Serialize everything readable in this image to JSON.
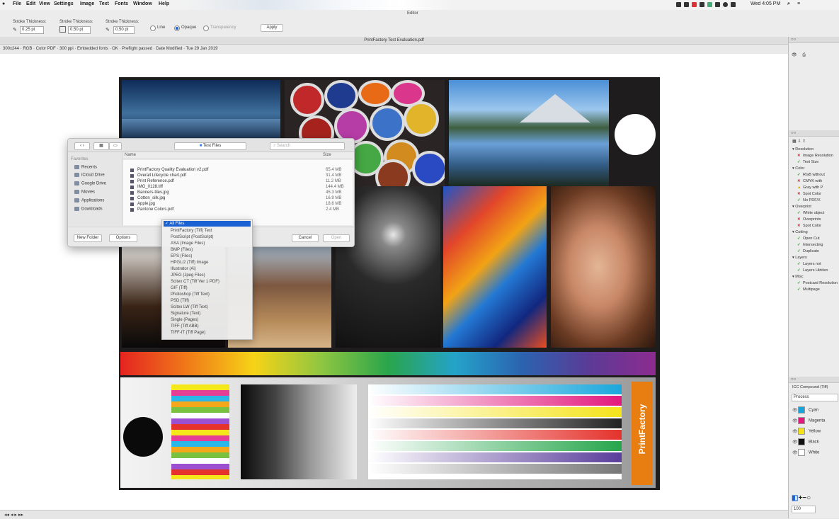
{
  "menubar": {
    "items": [
      "File",
      "Edit",
      "View",
      "Settings",
      "Image",
      "Text",
      "Fonts",
      "Window",
      "Help"
    ],
    "right_text": "Wed 4:05 PM"
  },
  "toolbar": {
    "title": "Editor",
    "group1_label": "Stroke Thickness:",
    "group1_value": "0.25 pt",
    "group2_label": "Stroke Thickness:",
    "group2_value": "0.50 pt",
    "group3_label": "Stroke Thickness:",
    "group3_value": "0.50 pt",
    "radio_labels": [
      "Line",
      "Opaque",
      "Transparency"
    ],
    "apply_label": "Apply"
  },
  "document": {
    "title": "PrintFactory Test Evaluation.pdf",
    "info": "300x244 · RGB · Color PDF · 300 ppi · Embedded fonts · OK · Preflight passed · Date Modified · Tue 29 Jan 2019",
    "brand_vertical": "PrintFactory"
  },
  "dialog": {
    "path_label": "Test Files",
    "search_placeholder": "Search",
    "column_name": "Name",
    "column_size": "Size",
    "sidebar_header": "Favorites",
    "sidebar": [
      "Recents",
      "iCloud Drive",
      "Google Drive",
      "Movies",
      "Applications",
      "Downloads"
    ],
    "files": [
      {
        "name": "PrintFactory Quality Evaluation v2.pdf",
        "size": "65.4 MB"
      },
      {
        "name": "Overall Lifecycle chart.pdf",
        "size": "31.4 MB"
      },
      {
        "name": "Print Reference.pdf",
        "size": "11.2 MB"
      },
      {
        "name": "IMG_0128.tiff",
        "size": "144.4 MB"
      },
      {
        "name": "Banners-tiles.jpg",
        "size": "45.3 MB"
      },
      {
        "name": "Cotton_silk.jpg",
        "size": "16.9 MB"
      },
      {
        "name": "Apple.jpg",
        "size": "18.6 MB"
      },
      {
        "name": "Pantone Colors.pdf",
        "size": "2.4 MB"
      }
    ],
    "new_folder_label": "New Folder",
    "options_label": "Options",
    "cancel_label": "Cancel",
    "open_label": "Open"
  },
  "format_menu": {
    "selected": "All Files",
    "options": [
      "PrintFactory (Tiff) Text",
      "PostScript (PostScript)",
      "ASA (Image Files)",
      "BMP (Files)",
      "EPS (Files)",
      "HPGL/2 (Tiff) Image",
      "Illustrator (Ai)",
      "JPEG (Jpeg Files)",
      "Scitex CT (Tiff Ver 1 PDF)",
      "GIF (Tiff)",
      "Photoshop (Tiff Text)",
      "PSD (Tiff)",
      "Scitex LW (Tiff Text)",
      "Signature (Text)",
      "Single (Pages)",
      "TIFF (Tiff ABB)",
      "TIFF-IT (Tiff Page)"
    ]
  },
  "preflight": {
    "items": [
      {
        "mark": "group",
        "label": "▾ Resolution"
      },
      {
        "mark": "bad",
        "label": "Image Resolution"
      },
      {
        "mark": "ok",
        "label": "Text Size"
      },
      {
        "mark": "group",
        "label": "▾ Color"
      },
      {
        "mark": "ok",
        "label": "RGB without"
      },
      {
        "mark": "bad",
        "label": "CMYK with"
      },
      {
        "mark": "warn",
        "label": "Gray with P"
      },
      {
        "mark": "bad",
        "label": "Spot Color"
      },
      {
        "mark": "ok",
        "label": "No PDF/X"
      },
      {
        "mark": "group",
        "label": "▾ Overprint"
      },
      {
        "mark": "ok",
        "label": "White object"
      },
      {
        "mark": "bad",
        "label": "Overprints"
      },
      {
        "mark": "bad",
        "label": "Spot Color"
      },
      {
        "mark": "group",
        "label": "▾ Cutting"
      },
      {
        "mark": "ok",
        "label": "Open Cut"
      },
      {
        "mark": "ok",
        "label": "Intersecting"
      },
      {
        "mark": "ok",
        "label": "Duplicate"
      },
      {
        "mark": "group",
        "label": "▾ Layers"
      },
      {
        "mark": "ok",
        "label": "Layers not"
      },
      {
        "mark": "ok",
        "label": "Layers Hidden"
      },
      {
        "mark": "group",
        "label": "▾ Misc"
      },
      {
        "mark": "ok",
        "label": "Postcard Resolution"
      },
      {
        "mark": "ok",
        "label": "Multipage"
      }
    ]
  },
  "separations": {
    "title": "Separations",
    "subtitle": "ICC Compound (Tiff)",
    "select_value": "Process",
    "channels": [
      {
        "name": "Cyan",
        "color": "#1aa3d9"
      },
      {
        "name": "Magenta",
        "color": "#e0197a"
      },
      {
        "name": "Yellow",
        "color": "#f2e21b"
      },
      {
        "name": "Black",
        "color": "#111111"
      },
      {
        "name": "White",
        "color": "#ffffff"
      }
    ],
    "zoom": "100"
  },
  "colors": {
    "accent": "#1a62d3",
    "sheet": "#1f1c1d",
    "brand_orange": "#e87e11"
  }
}
